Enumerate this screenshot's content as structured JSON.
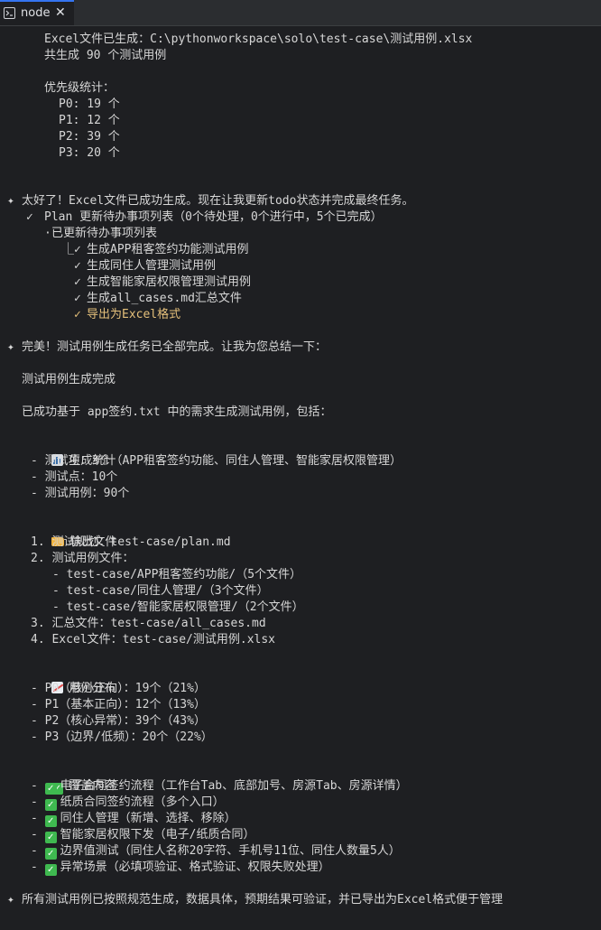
{
  "tab": {
    "title": "node",
    "close": "✕",
    "icon": "terminal-icon"
  },
  "lines": {
    "l1": "Excel文件已生成：C:\\pythonworkspace\\solo\\test-case\\测试用例.xlsx",
    "l2": "共生成 90 个测试用例",
    "l3": "优先级统计：",
    "l4": "P0: 19 个",
    "l5": "P1: 12 个",
    "l6": "P2: 39 个",
    "l7": "P3: 20 个",
    "l8": "太好了！Excel文件已成功生成。现在让我更新todo状态并完成最终任务。",
    "l9": "Plan 更新待办事项列表（0个待处理，0个进行中，5个已完成）",
    "l10": "已更新待办事项列表",
    "l11": "生成APP租客签约功能测试用例",
    "l12": "生成同住人管理测试用例",
    "l13": "生成智能家居权限管理测试用例",
    "l14": "生成all_cases.md汇总文件",
    "l15": "导出为Excel格式",
    "l16": "完美！测试用例生成任务已全部完成。让我为您总结一下：",
    "l17": "测试用例生成完成",
    "l18": "已成功基于 app签约.txt 中的需求生成测试用例，包括：",
    "l19": "生成统计",
    "l20": "- 测试项：3个（APP租客签约功能、同住人管理、智能家居权限管理）",
    "l21": "- 测试点：10个",
    "l22": "- 测试用例：90个",
    "l23": "输出文件",
    "l24": "1. 测试规划：test-case/plan.md",
    "l25": "2. 测试用例文件：",
    "l26": "- test-case/APP租客签约功能/（5个文件）",
    "l27": "- test-case/同住人管理/（3个文件）",
    "l28": "- test-case/智能家居权限管理/（2个文件）",
    "l29": "3. 汇总文件：test-case/all_cases.md",
    "l30": "4. Excel文件：test-case/测试用例.xlsx",
    "l31": "用例分布",
    "l32": "- P0（核心正向）：19个（21%）",
    "l33": "- P1（基本正向）：12个（13%）",
    "l34": "- P2（核心异常）：39个（43%）",
    "l35": "- P3（边界/低频）：20个（22%）",
    "l36": "覆盖内容",
    "l37": "电子合同签约流程（工作台Tab、底部加号、房源Tab、房源详情）",
    "l38": "纸质合同签约流程（多个入口）",
    "l39": "同住人管理（新增、选择、移除）",
    "l40": "智能家居权限下发（电子/纸质合同）",
    "l41": "边界值测试（同住人名称20字符、手机号11位、同住人数量5人）",
    "l42": "异常场景（必填项验证、格式验证、权限失败处理）",
    "l43": "所有测试用例已按照规范生成，数据具体，预期结果可验证，并已导出为Excel格式便于管理"
  },
  "symbols": {
    "star": "✦",
    "check": "✓",
    "bullet": "·",
    "tree": "⎿",
    "dash": "-",
    "checkbox": "✓"
  },
  "colors": {
    "done_highlight": "#e5c07b",
    "checkbox": "#3fb950"
  }
}
